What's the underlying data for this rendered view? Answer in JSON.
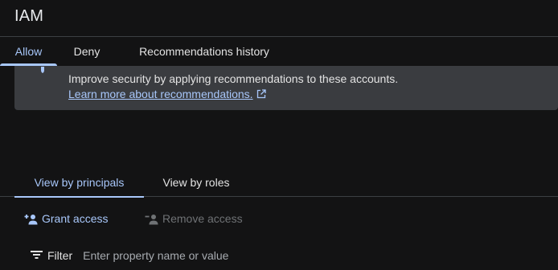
{
  "header": {
    "title": "IAM"
  },
  "top_tabs": [
    {
      "label": "Allow",
      "active": true
    },
    {
      "label": "Deny",
      "active": false
    },
    {
      "label": "Recommendations history",
      "active": false
    }
  ],
  "banner": {
    "text": "Improve security by applying recommendations to these accounts.",
    "link_label": "Learn more about recommendations.",
    "icon": "lightbulb-icon",
    "link_icon": "open-in-new-icon"
  },
  "view_tabs": [
    {
      "label": "View by principals",
      "active": true
    },
    {
      "label": "View by roles",
      "active": false
    }
  ],
  "actions": {
    "grant_label": "Grant access",
    "grant_icon": "person-add-icon",
    "remove_label": "Remove access",
    "remove_icon": "person-remove-icon"
  },
  "filter": {
    "label": "Filter",
    "placeholder": "Enter property name or value",
    "value": "",
    "icon": "filter-list-icon"
  },
  "colors": {
    "background": "#131314",
    "accent": "#a8c7fa",
    "banner_bg": "#3a3c40",
    "divider": "#3c4043",
    "disabled": "#6f7275"
  }
}
